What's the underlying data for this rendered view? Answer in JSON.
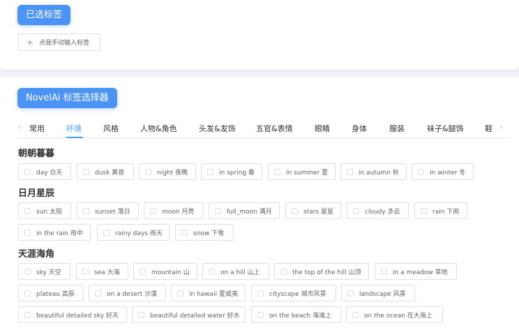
{
  "selected": {
    "badge": "已选标签",
    "manual_button": "点我手动输入标签"
  },
  "selector": {
    "badge": "NovelAi 标签选择器",
    "tabs": [
      "常用",
      "环境",
      "风格",
      "人物&角色",
      "头发&发饰",
      "五官&表情",
      "眼睛",
      "身体",
      "服装",
      "袜子&腿饰",
      "鞋"
    ],
    "active_tab": "环境"
  },
  "groups": [
    {
      "title": "朝朝暮暮",
      "chips": [
        "day 白天",
        "dusk 黄昏",
        "night 夜晚",
        "in spring 春",
        "in summer 夏",
        "in autumn 秋",
        "in winter 冬"
      ]
    },
    {
      "title": "日月星辰",
      "chips": [
        "sun 太阳",
        "sunset 落日",
        "moon 月亮",
        "full_moon 满月",
        "stars 星星",
        "cloudy 多云",
        "rain 下雨",
        "in the rain 雨中",
        "rainy days 雨天",
        "snow 下雪"
      ]
    },
    {
      "title": "天涯海角",
      "chips": [
        "sky 天空",
        "sea 大海",
        "mountain 山",
        "on a hill 山上",
        "the top of the hill 山顶",
        "in a meadow 草地",
        "plateau 高原",
        "on a desert 沙漠",
        "in hawaii 夏威夷",
        "cityscape 城市风景",
        "landscape 风景",
        "beautiful detailed sky 好天",
        "beautiful detailed water 好水",
        "on the beach 海滩上",
        "on the ocean 在大海上"
      ]
    }
  ],
  "colors": {
    "accent": "#409eff",
    "badge": "#4b93f5"
  }
}
